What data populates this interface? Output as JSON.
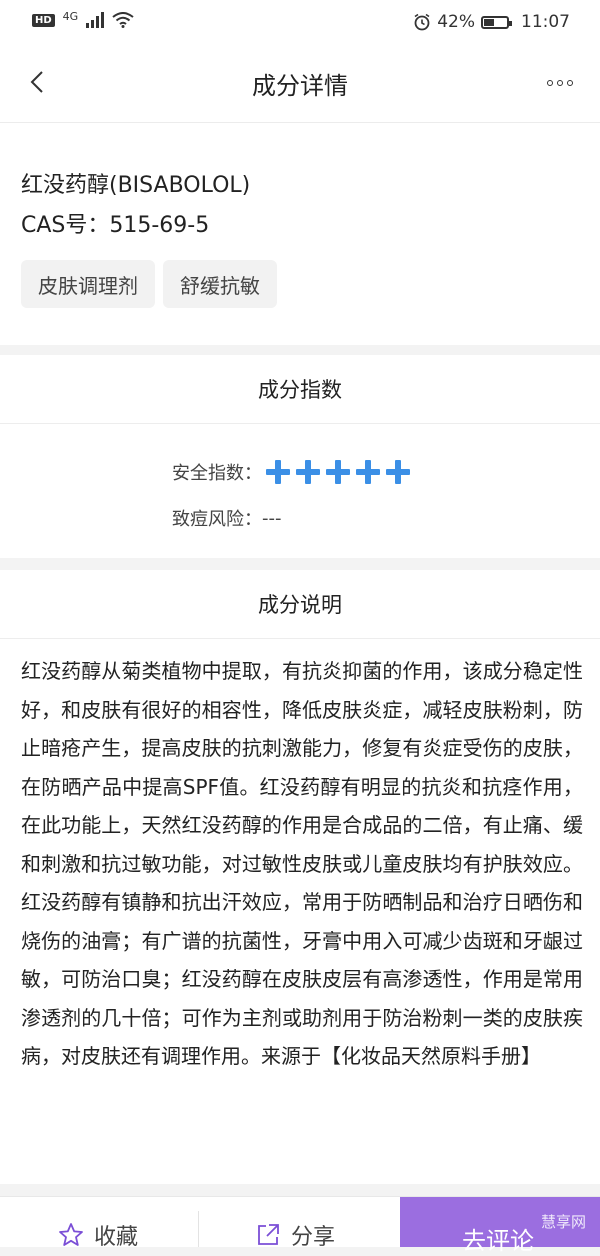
{
  "status_bar": {
    "hd": "HD",
    "signal": "4G",
    "battery_pct": "42%",
    "time": "11:07"
  },
  "nav": {
    "title": "成分详情"
  },
  "ingredient": {
    "name": "红没药醇(BISABOLOL)",
    "cas": "CAS号：515-69-5",
    "tags": [
      "皮肤调理剂",
      "舒缓抗敏"
    ]
  },
  "index_section": {
    "title": "成分指数",
    "safety_label": "安全指数：",
    "safety_level": 5,
    "acne_label": "致痘风险：",
    "acne_value": "---"
  },
  "desc_section": {
    "title": "成分说明",
    "text": "红没药醇从菊类植物中提取，有抗炎抑菌的作用，该成分稳定性好，和皮肤有很好的相容性，降低皮肤炎症，减轻皮肤粉刺，防止暗疮产生，提高皮肤的抗刺激能力，修复有炎症受伤的皮肤，在防晒产品中提高SPF值。红没药醇有明显的抗炎和抗痉作用，在此功能上，天然红没药醇的作用是合成品的二倍，有止痛、缓和刺激和抗过敏功能，对过敏性皮肤或儿童皮肤均有护肤效应。红没药醇有镇静和抗出汗效应，常用于防晒制品和治疗日晒伤和烧伤的油膏；有广谱的抗菌性，牙膏中用入可减少齿斑和牙龈过敏，可防治口臭；红没药醇在皮肤皮层有高渗透性，作用是常用渗透剂的几十倍；可作为主剂或助剂用于防治粉刺一类的皮肤疾病，对皮肤还有调理作用。来源于【化妆品天然原料手册】"
  },
  "bottom_bar": {
    "favorite": "收藏",
    "share": "分享",
    "comment": "去评论",
    "watermark": "慧享网"
  },
  "colors": {
    "accent_blue": "#3b8fe6",
    "comment_purple": "#9b6ee0"
  }
}
